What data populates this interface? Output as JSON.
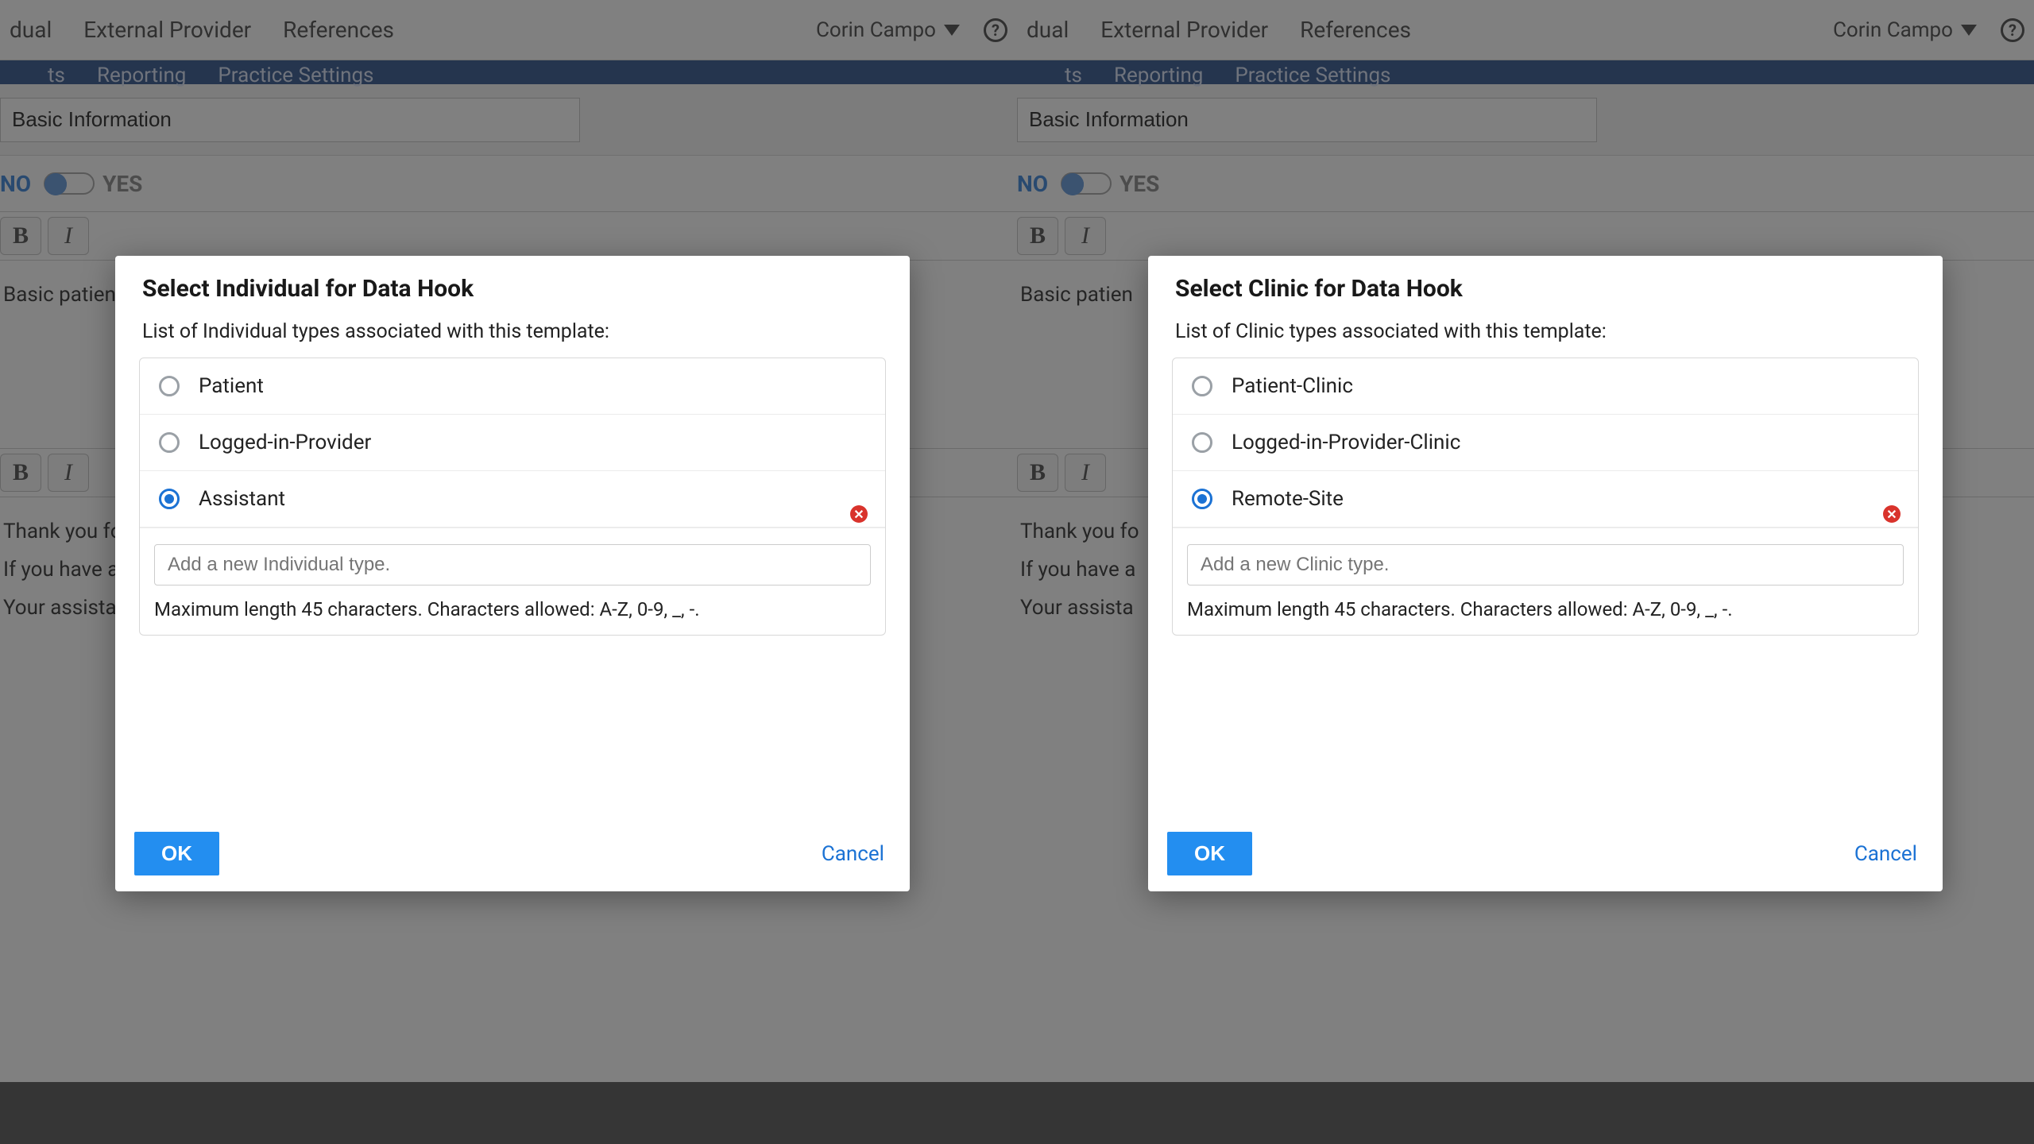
{
  "topbar": {
    "menu": [
      "dual",
      "External Provider",
      "References"
    ],
    "user": "Corin Campo"
  },
  "subnav": [
    "ts",
    "Reporting",
    "Practice Settings"
  ],
  "section_input": "Basic Information",
  "toggle": {
    "no": "NO",
    "yes": "YES"
  },
  "body": {
    "p1": "Basic patien",
    "p2": "Thank you fo",
    "p3": "If you have a",
    "p4": "Your assista"
  },
  "modal_left": {
    "title": "Select Individual for Data Hook",
    "subtitle": "List of Individual types associated with this template:",
    "options": [
      "Patient",
      "Logged-in-Provider",
      "Assistant"
    ],
    "selected_index": 2,
    "add_placeholder": "Add a new Individual type.",
    "helper": "Maximum length 45 characters. Characters allowed: A-Z, 0-9, _, -.",
    "ok": "OK",
    "cancel": "Cancel"
  },
  "modal_right": {
    "title": "Select Clinic for Data Hook",
    "subtitle": "List of Clinic types associated with this template:",
    "options": [
      "Patient-Clinic",
      "Logged-in-Provider-Clinic",
      "Remote-Site"
    ],
    "selected_index": 2,
    "add_placeholder": "Add a new Clinic type.",
    "helper": "Maximum length 45 characters. Characters allowed: A-Z, 0-9, _, -.",
    "ok": "OK",
    "cancel": "Cancel"
  }
}
